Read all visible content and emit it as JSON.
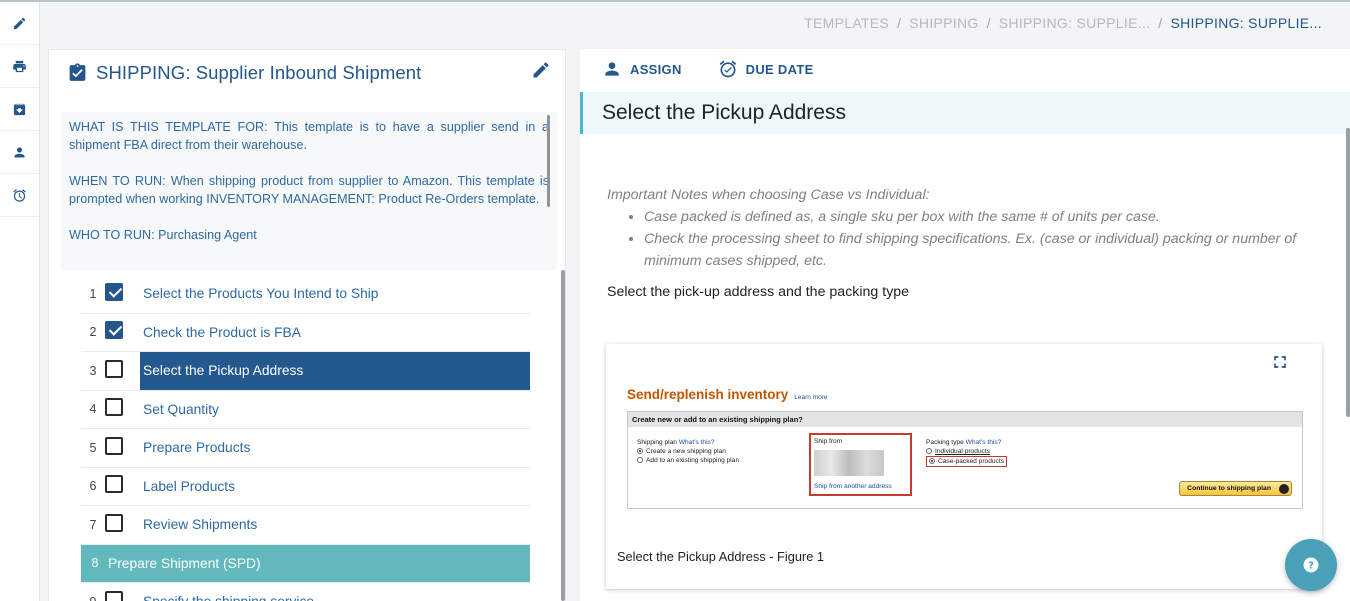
{
  "breadcrumb": [
    "TEMPLATES",
    "SHIPPING",
    "SHIPPING: SUPPLIE...",
    "SHIPPING: SUPPLIE..."
  ],
  "rail": [
    "edit-icon",
    "print-icon",
    "archive-icon",
    "person-icon",
    "alarm-icon"
  ],
  "template": {
    "title": "SHIPPING: Supplier Inbound Shipment",
    "description": [
      "WHAT IS THIS TEMPLATE FOR: This template is to have a supplier send in a shipment FBA direct from their warehouse.",
      "WHEN TO RUN: When shipping product from supplier to Amazon. This template is prompted when working INVENTORY MANAGEMENT: Product Re-Orders template.",
      "WHO TO RUN: Purchasing Agent"
    ],
    "steps": [
      {
        "num": "1",
        "label": "Select the Products You Intend to Ship",
        "checked": true
      },
      {
        "num": "2",
        "label": "Check the Product is FBA",
        "checked": true
      },
      {
        "num": "3",
        "label": "Select the Pickup Address",
        "checked": false,
        "selected": true
      },
      {
        "num": "4",
        "label": "Set Quantity",
        "checked": false
      },
      {
        "num": "5",
        "label": "Prepare Products",
        "checked": false
      },
      {
        "num": "6",
        "label": "Label Products",
        "checked": false
      },
      {
        "num": "7",
        "label": "Review Shipments",
        "checked": false
      },
      {
        "num": "8",
        "label": "Prepare Shipment (SPD)",
        "section": true
      },
      {
        "num": "9",
        "label": "Specify the shipping service",
        "checked": false
      }
    ]
  },
  "actions": {
    "assign": "ASSIGN",
    "due_date": "DUE DATE"
  },
  "step_detail": {
    "title": "Select the Pickup Address",
    "notes_heading": "Important Notes when choosing Case vs Individual:",
    "notes": [
      "Case packed is defined as, a single sku per box with the same # of units per case.",
      "Check the processing sheet to find shipping specifications. Ex. (case or individual) packing or number of minimum cases shipped, etc."
    ],
    "instruction": "Select the pick-up address and the packing type",
    "figure_caption": "Select the Pickup Address - Figure 1"
  },
  "figure": {
    "title": "Send/replenish inventory",
    "learn_more": "Learn more",
    "question": "Create new or add to an existing shipping plan?",
    "plan_label": "Shipping plan",
    "plan_help": "What's this?",
    "plan_options": [
      "Create a new shipping plan",
      "Add to an existing shipping plan"
    ],
    "ship_from_label": "Ship from",
    "ship_from_link": "Ship from another address",
    "packing_label": "Packing type",
    "packing_help": "What's this?",
    "packing_options": [
      "Individual products",
      "Case-packed products"
    ],
    "continue_button": "Continue to shipping plan"
  },
  "colors": {
    "brand": "#24568c",
    "selected": "#23598f",
    "section": "#62b9bd",
    "accent": "#4fb4d8",
    "fab": "#4aa0b8"
  }
}
